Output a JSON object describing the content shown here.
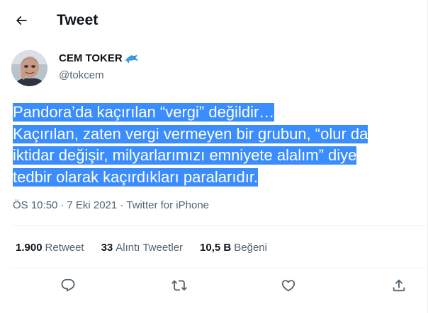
{
  "header": {
    "title": "Tweet",
    "back_icon": "arrow-left-icon"
  },
  "author": {
    "name": "CEM TOKER",
    "name_emoji": "dolphin-icon",
    "handle": "@tokcem"
  },
  "tweet": {
    "lines": [
      "Pandora’da kaçırılan “vergi” değildir…",
      "Kaçırılan, zaten vergi vermeyen bir grubun, “olur da",
      "iktidar değişir, milyarlarımızı emniyete alalım” diye",
      "tedbir olarak kaçırdıkları paralarıdır."
    ],
    "highlight_color": "#3b8dfd"
  },
  "meta": {
    "time": "ÖS 10:50",
    "sep1": "·",
    "date": "7 Eki 2021",
    "sep2": "·",
    "source": "Twitter for iPhone"
  },
  "stats": {
    "retweets": {
      "count": "1.900",
      "label": "Retweet"
    },
    "quotes": {
      "count": "33",
      "label": "Alıntı Tweetler"
    },
    "likes": {
      "count": "10,5 B",
      "label": "Beğeni"
    }
  },
  "actions": [
    "reply-icon",
    "retweet-icon",
    "like-icon",
    "share-icon"
  ],
  "colors": {
    "text": "#0f1419",
    "secondary": "#536471",
    "divider": "#eff3f4",
    "accent": "#1d9bf0"
  }
}
